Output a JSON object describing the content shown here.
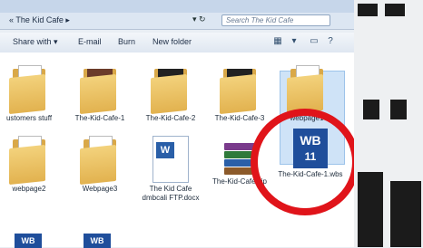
{
  "breadcrumb": "« The Kid Cafe ▸",
  "search": {
    "placeholder": "Search The Kid Cafe"
  },
  "toolbar": {
    "share_with": "Share with ▾",
    "email": "E-mail",
    "burn": "Burn",
    "new_folder": "New folder"
  },
  "files": [
    {
      "label": "ustomers stuff"
    },
    {
      "label": "The-Kid-Cafe-1"
    },
    {
      "label": "The-Kid-Cafe-2"
    },
    {
      "label": "The-Kid-Cafe-3"
    },
    {
      "label": "webpage1"
    },
    {
      "label": "webpage2"
    },
    {
      "label": "Webpage3"
    },
    {
      "label": "The Kid Cafe dmbcali FTP.docx"
    },
    {
      "label": "The-Kid-Cafe.zip"
    },
    {
      "label": "The-Kid-Cafe-1.wbs"
    }
  ],
  "wb_badge": "WB",
  "wb_number": "11",
  "doc_badge": "W",
  "colors": {
    "highlight": "#e0141a",
    "folder": "#e2b24f",
    "wb": "#1f4e9b"
  }
}
